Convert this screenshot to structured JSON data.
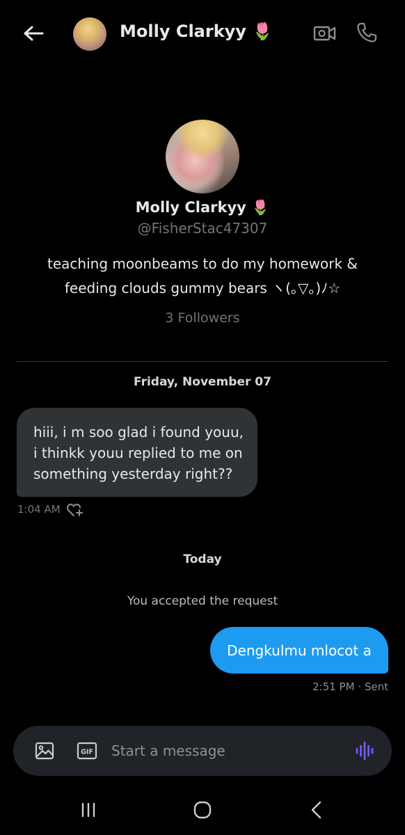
{
  "header": {
    "name": "Molly Clarkyy 🌷",
    "icons": {
      "back": "arrow-left-icon",
      "video": "video-camera-icon",
      "call": "phone-icon"
    }
  },
  "profile": {
    "name": "Molly Clarkyy 🌷",
    "handle": "@FisherStac47307",
    "bio_line1": "teaching moonbeams to do my homework &",
    "bio_line2": "feeding clouds gummy bears ヽ(｡▽｡)ﾉ☆",
    "followers": "3 Followers"
  },
  "conversation": {
    "date_separator": "Friday, November 07",
    "received_message": {
      "line1": "hiii, i m soo glad i found youu,",
      "line2": "i thinkk youu replied to me on",
      "line3": "something yesterday right??",
      "time": "1:04 AM"
    },
    "today_separator": "Today",
    "system_notice": "You accepted the request",
    "sent_message": {
      "text": "Dengkulmu mlocot a",
      "status": "2:51 PM · Sent"
    }
  },
  "composer": {
    "placeholder": "Start a message",
    "gif_label": "GIF"
  },
  "colors": {
    "background": "#000000",
    "accent": "#1d9bf0",
    "received_bubble": "#2f3336",
    "muted_text": "#71767b",
    "voice_icon": "#7856ff"
  }
}
